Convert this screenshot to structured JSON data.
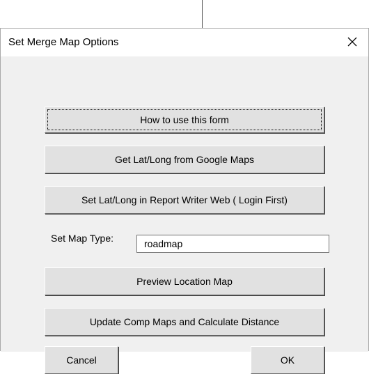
{
  "dialog": {
    "title": "Set Merge Map Options",
    "close_icon": "close-icon"
  },
  "buttons": {
    "how_to": "How to use this form",
    "get_latlong": "Get Lat/Long from Google Maps",
    "set_latlong": "Set Lat/Long in Report Writer Web ( Login First)",
    "preview_map": "Preview Location Map",
    "update_comp": "Update Comp Maps and Calculate Distance",
    "cancel": "Cancel",
    "ok": "OK"
  },
  "map_type": {
    "label": "Set Map Type:",
    "value": "roadmap"
  }
}
